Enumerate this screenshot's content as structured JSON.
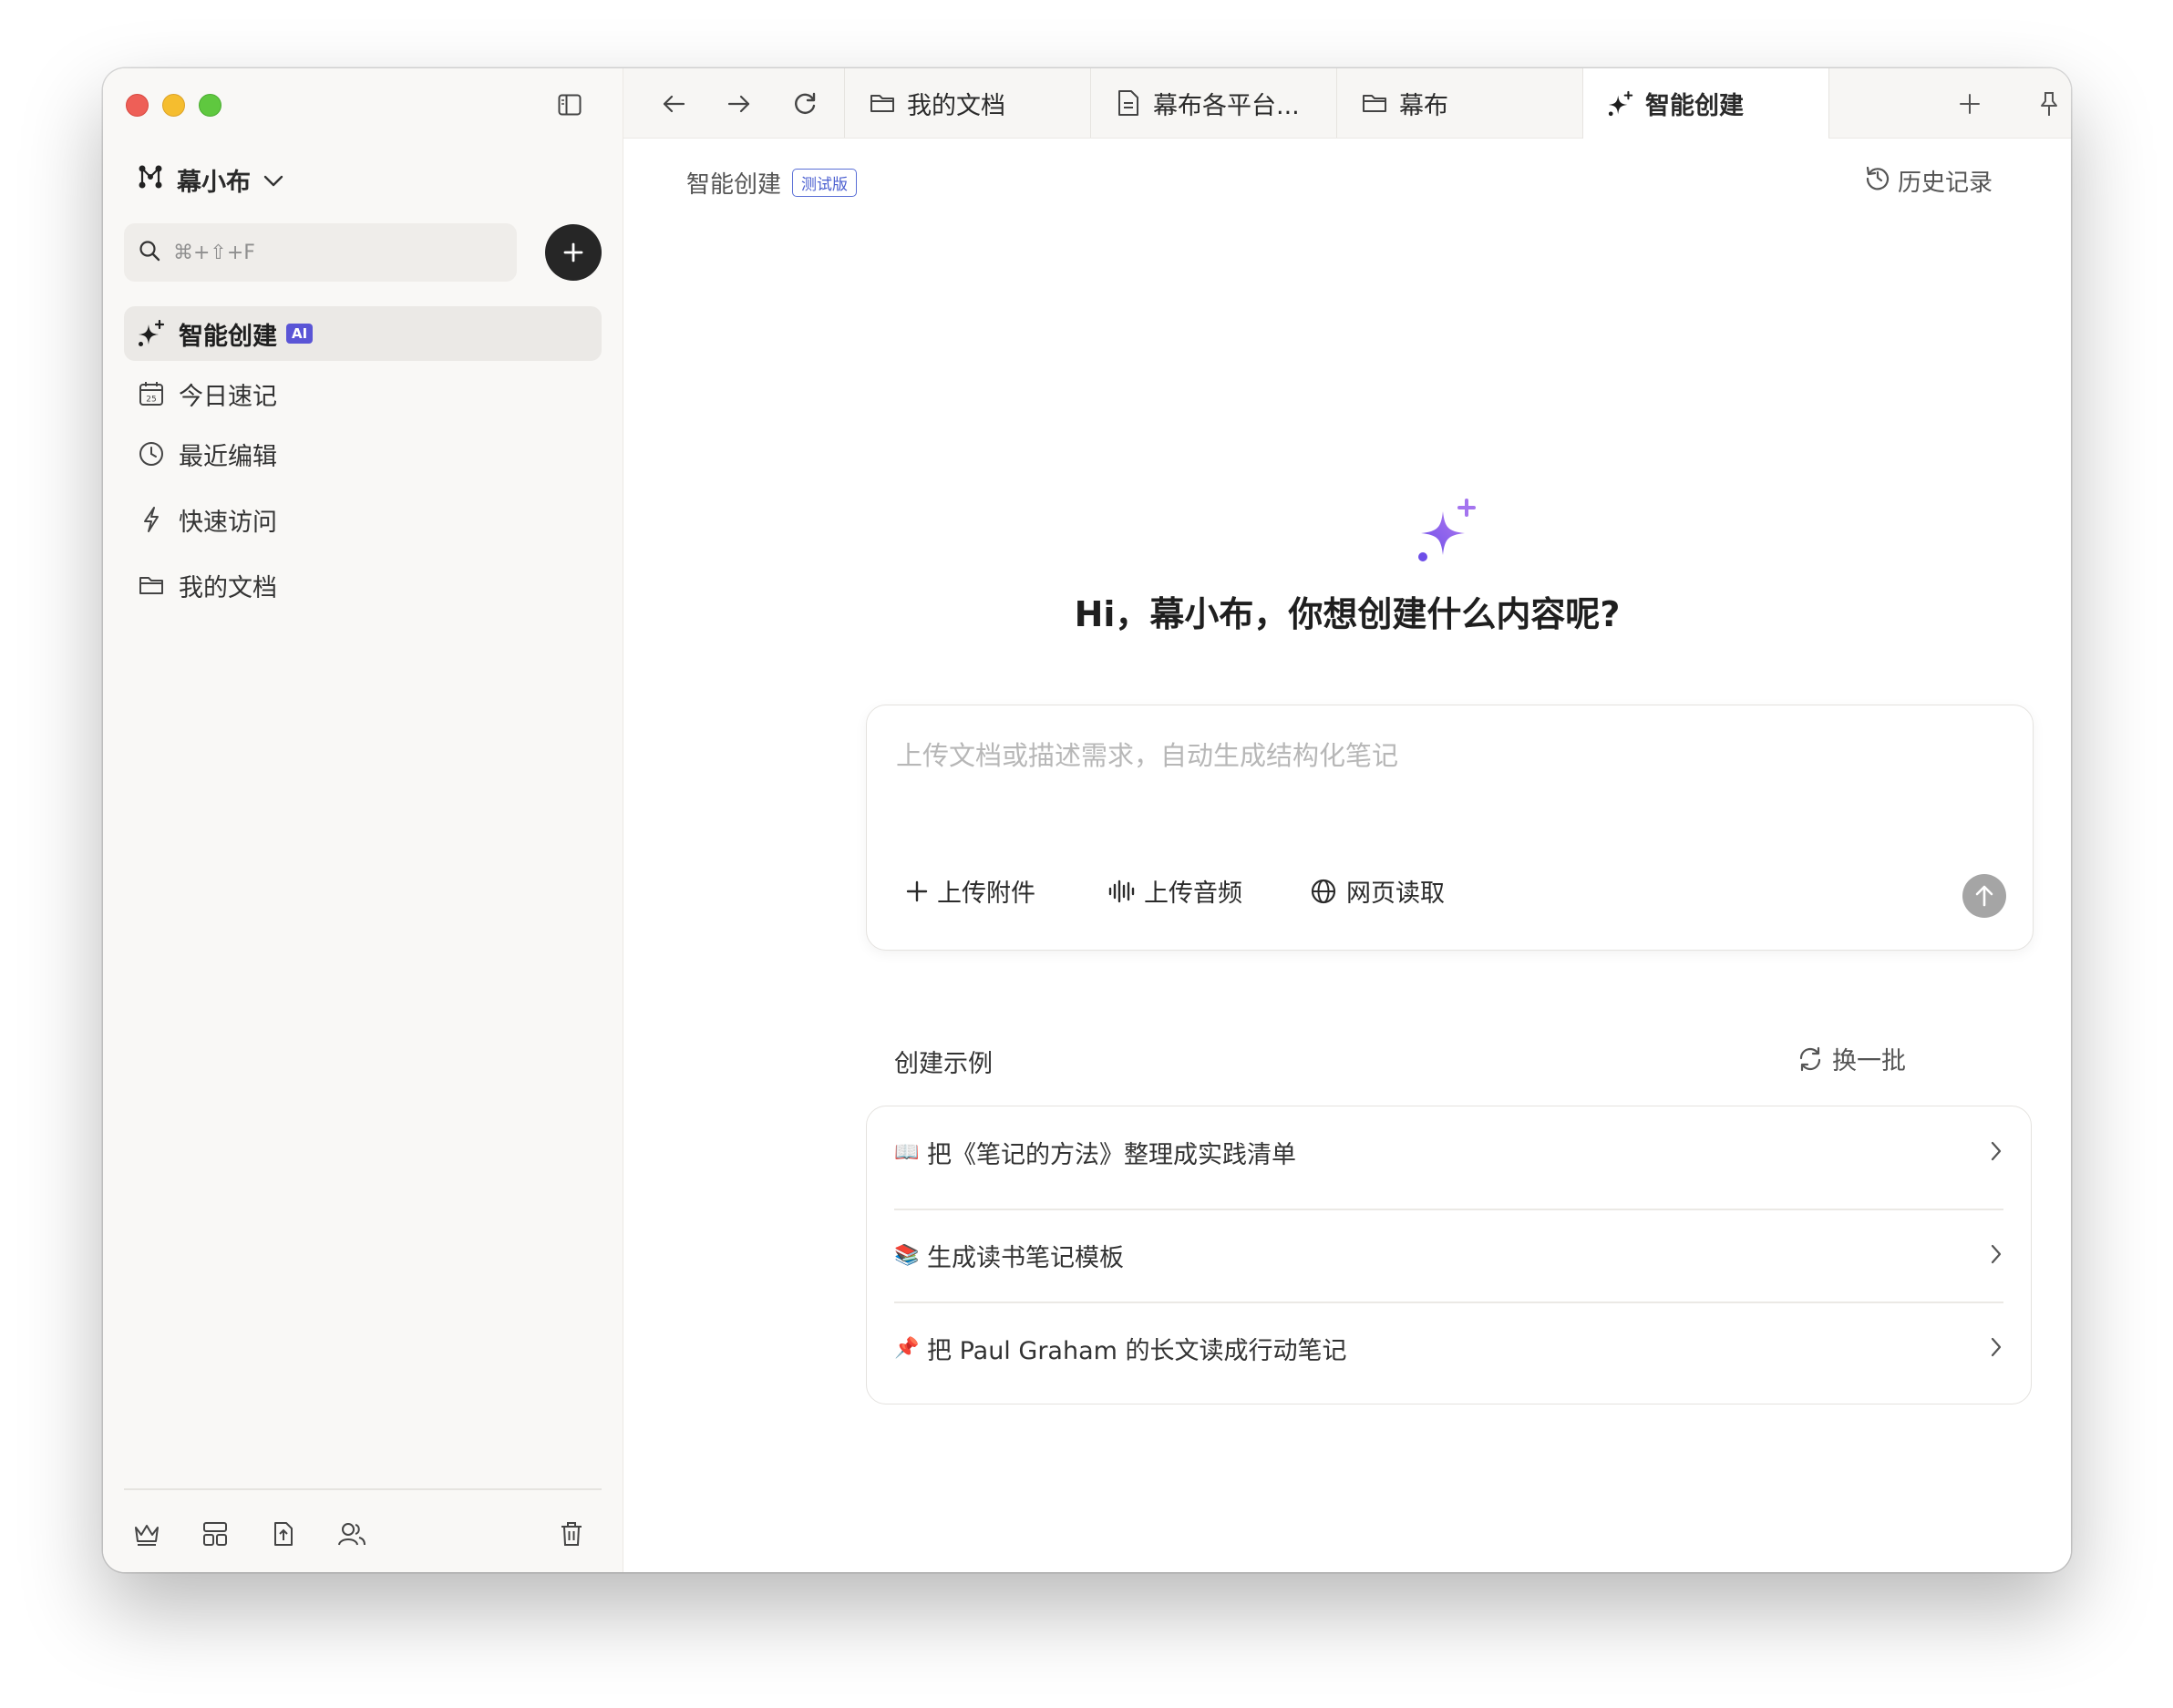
{
  "sidebar": {
    "workspace_name": "幕小布",
    "search_placeholder": "⌘+⇧+F",
    "nav": [
      {
        "label": "智能创建",
        "badge": "AI",
        "icon": "sparkle-icon",
        "active": true
      },
      {
        "label": "今日速记",
        "icon": "calendar-icon",
        "calendar_day": "25"
      },
      {
        "label": "最近编辑",
        "icon": "clock-icon"
      },
      {
        "label": "快速访问",
        "icon": "bolt-icon"
      },
      {
        "label": "我的文档",
        "icon": "folder-icon"
      }
    ]
  },
  "tabs": [
    {
      "label": "我的文档",
      "icon": "folder-icon"
    },
    {
      "label": "幕布各平台...",
      "icon": "document-icon"
    },
    {
      "label": "幕布",
      "icon": "folder-icon"
    },
    {
      "label": "智能创建",
      "icon": "sparkle-icon",
      "active": true
    }
  ],
  "header": {
    "breadcrumb": "智能创建",
    "beta_badge": "测试版",
    "history_label": "历史记录"
  },
  "hero": {
    "greeting": "Hi，幕小布，你想创建什么内容呢?"
  },
  "composer": {
    "placeholder": "上传文档或描述需求，自动生成结构化笔记",
    "upload_attachment": "上传附件",
    "upload_audio": "上传音频",
    "web_read": "网页读取"
  },
  "examples": {
    "title": "创建示例",
    "refresh_label": "换一批",
    "items": [
      {
        "emoji": "📖",
        "text": "把《笔记的方法》整理成实践清单"
      },
      {
        "emoji": "📚",
        "text": "生成读书笔记模板"
      },
      {
        "emoji": "📌",
        "text": "把 Paul Graham 的长文读成行动笔记"
      }
    ]
  },
  "colors": {
    "accent": "#5a55d6",
    "sparkle": "#8b5cf6",
    "send_disabled": "#a5a5a5"
  }
}
